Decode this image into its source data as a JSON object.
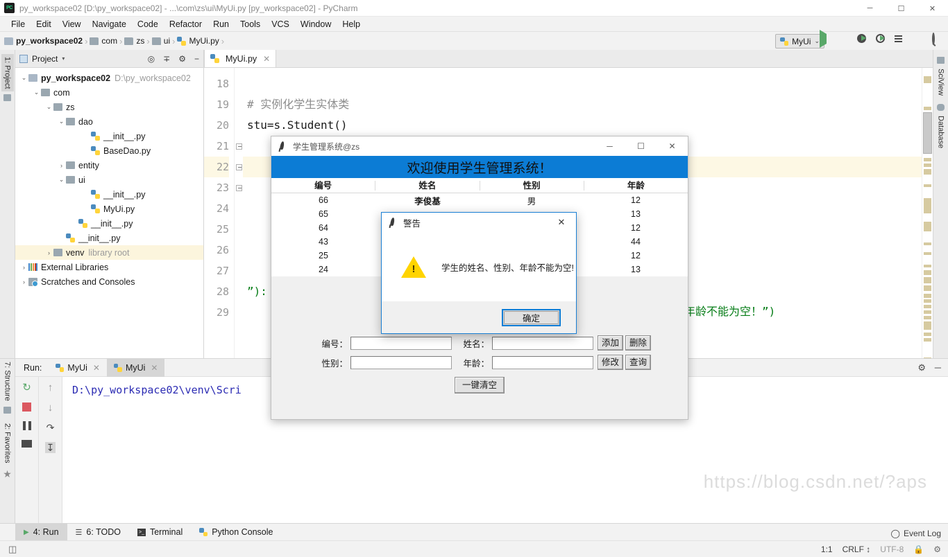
{
  "window": {
    "title": "py_workspace02 [D:\\py_workspace02] - ...\\com\\zs\\ui\\MyUi.py [py_workspace02] - PyCharm",
    "logo": "PC",
    "minimize": "─",
    "maximize": "☐",
    "close": "✕"
  },
  "menubar": {
    "items": [
      "File",
      "Edit",
      "View",
      "Navigate",
      "Code",
      "Refactor",
      "Run",
      "Tools",
      "VCS",
      "Window",
      "Help"
    ]
  },
  "breadcrumb": {
    "items": [
      "py_workspace02",
      "com",
      "zs",
      "ui",
      "MyUi.py"
    ]
  },
  "toolbar": {
    "run_config": "MyUi",
    "dropdown_caret": "⌄",
    "icons": [
      "run-icon",
      "debug-icon",
      "coverage-icon",
      "profile-icon",
      "run-with-params-icon",
      "stop-icon",
      "search-icon"
    ]
  },
  "left_sidebar": {
    "top": [
      "1: Project"
    ],
    "bottom": [
      "7: Structure",
      "2: Favorites"
    ]
  },
  "right_sidebar": {
    "items": [
      "SciView",
      "Database"
    ]
  },
  "project_pane": {
    "title": "Project",
    "caret": "▾",
    "tree": [
      {
        "indent": 0,
        "arrow": "⌄",
        "icon": "folder",
        "label": "py_workspace02",
        "bold": true,
        "dim": "D:\\py_workspace02",
        "highlight": false
      },
      {
        "indent": 1,
        "arrow": "⌄",
        "icon": "folder",
        "label": "com",
        "bold": false,
        "dim": "",
        "highlight": false
      },
      {
        "indent": 2,
        "arrow": "⌄",
        "icon": "folder",
        "label": "zs",
        "bold": false,
        "dim": "",
        "highlight": false
      },
      {
        "indent": 3,
        "arrow": "⌄",
        "icon": "folder",
        "label": "dao",
        "bold": false,
        "dim": "",
        "highlight": false
      },
      {
        "indent": 5,
        "arrow": "",
        "icon": "python",
        "label": "__init__.py",
        "bold": false,
        "dim": "",
        "highlight": false
      },
      {
        "indent": 5,
        "arrow": "",
        "icon": "python",
        "label": "BaseDao.py",
        "bold": false,
        "dim": "",
        "highlight": false
      },
      {
        "indent": 3,
        "arrow": "›",
        "icon": "folder",
        "label": "entity",
        "bold": false,
        "dim": "",
        "highlight": false
      },
      {
        "indent": 3,
        "arrow": "⌄",
        "icon": "folder",
        "label": "ui",
        "bold": false,
        "dim": "",
        "highlight": false
      },
      {
        "indent": 5,
        "arrow": "",
        "icon": "python",
        "label": "__init__.py",
        "bold": false,
        "dim": "",
        "highlight": false
      },
      {
        "indent": 5,
        "arrow": "",
        "icon": "python",
        "label": "MyUi.py",
        "bold": false,
        "dim": "",
        "highlight": false
      },
      {
        "indent": 4,
        "arrow": "",
        "icon": "python",
        "label": "__init__.py",
        "bold": false,
        "dim": "",
        "highlight": false
      },
      {
        "indent": 3,
        "arrow": "",
        "icon": "python",
        "label": "__init__.py",
        "bold": false,
        "dim": "",
        "highlight": false
      },
      {
        "indent": 2,
        "arrow": "›",
        "icon": "folder",
        "label": "venv",
        "bold": false,
        "dim": "library root",
        "highlight": true
      },
      {
        "indent": 0,
        "arrow": "›",
        "icon": "library",
        "label": "External Libraries",
        "bold": false,
        "dim": "",
        "highlight": false
      },
      {
        "indent": 0,
        "arrow": "›",
        "icon": "scratch",
        "label": "Scratches and Consoles",
        "bold": false,
        "dim": "",
        "highlight": false
      }
    ]
  },
  "editor": {
    "tab": {
      "label": "MyUi.py",
      "close": "✕"
    },
    "lines": [
      {
        "num": "18",
        "text": "",
        "kind": "plain",
        "highlight": false,
        "fold": false
      },
      {
        "num": "19",
        "text": "# 实例化学生实体类",
        "kind": "comment",
        "highlight": false,
        "fold": false
      },
      {
        "num": "20",
        "text": "stu=s.Student()",
        "kind": "plain",
        "highlight": false,
        "fold": false
      },
      {
        "num": "21",
        "text": "",
        "kind": "plain",
        "highlight": false,
        "fold": true
      },
      {
        "num": "22",
        "text": "",
        "kind": "plain",
        "highlight": true,
        "fold": true
      },
      {
        "num": "23",
        "text": "",
        "kind": "plain",
        "highlight": false,
        "fold": true
      },
      {
        "num": "24",
        "text": "",
        "kind": "plain",
        "highlight": false,
        "fold": false
      },
      {
        "num": "25",
        "text": "",
        "kind": "plain",
        "highlight": false,
        "fold": false
      },
      {
        "num": "26",
        "text": "",
        "kind": "plain",
        "highlight": false,
        "fold": false
      },
      {
        "num": "27",
        "text": "",
        "kind": "plain",
        "highlight": false,
        "fold": false
      },
      {
        "num": "28",
        "text": "”):",
        "kind": "str",
        "highlight": false,
        "fold": false
      },
      {
        "num": "29",
        "text": "",
        "kind": "plain",
        "highlight": false,
        "fold": false
      }
    ],
    "fragment_28": "”):",
    "fragment_29": "别、年龄不能为空！”)"
  },
  "run_panel": {
    "label": "Run:",
    "tabs": [
      {
        "label": "MyUi",
        "selected": false,
        "close": "✕"
      },
      {
        "label": "MyUi",
        "selected": true,
        "close": "✕"
      }
    ],
    "console_text": "D:\\py_workspace02\\venv\\Scri",
    "gear": "⚙",
    "minimize": "─"
  },
  "bottom_tabs": [
    {
      "label": "4: Run",
      "icon": "run-icon",
      "selected": true
    },
    {
      "label": "6: TODO",
      "icon": "todo-icon",
      "selected": false
    },
    {
      "label": "Terminal",
      "icon": "terminal-icon",
      "selected": false
    },
    {
      "label": "Python Console",
      "icon": "python-icon",
      "selected": false
    }
  ],
  "status_bar": {
    "event_log": "Event Log",
    "position": "1:1",
    "line_sep": "CRLF",
    "encoding": "UTF-8",
    "lock_icon": "lock-icon",
    "branch_icon": "branch-icon"
  },
  "watermark": "https://blog.csdn.net/?aps",
  "tk_window": {
    "title": "学生管理系统@zs",
    "banner": "欢迎使用学生管理系统！",
    "banner_color": "#0c7cd5",
    "minimize": "─",
    "maximize": "☐",
    "close": "✕",
    "table": {
      "headers": [
        "编号",
        "姓名",
        "性别",
        "年龄"
      ],
      "rows": [
        {
          "id": "66",
          "name": "李俊基",
          "gender": "男",
          "age": "12"
        },
        {
          "id": "65",
          "name": "",
          "gender": "",
          "age": "13"
        },
        {
          "id": "64",
          "name": "",
          "gender": "",
          "age": "12"
        },
        {
          "id": "43",
          "name": "",
          "gender": "",
          "age": "44"
        },
        {
          "id": "25",
          "name": "",
          "gender": "",
          "age": "12"
        },
        {
          "id": "24",
          "name": "",
          "gender": "",
          "age": "13"
        }
      ]
    },
    "form": {
      "id_label": "编号：",
      "id_value": "",
      "name_label": "姓名：",
      "name_value": "",
      "gender_label": "性别：",
      "gender_value": "",
      "age_label": "年龄：",
      "age_value": "",
      "btn_add": "添加",
      "btn_delete": "删除",
      "btn_modify": "修改",
      "btn_query": "查询",
      "btn_clear": "一键清空"
    }
  },
  "dialog": {
    "title": "警告",
    "close": "✕",
    "message": "学生的姓名、性别、年龄不能为空!",
    "ok_label": "确定",
    "icon": "warning-triangle-icon",
    "accent_color": "#0c7cd5"
  }
}
